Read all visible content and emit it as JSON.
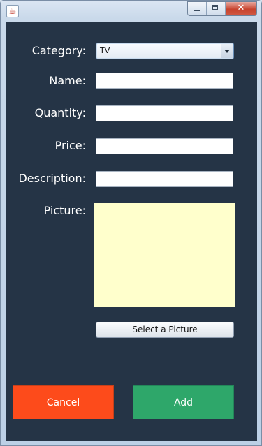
{
  "window": {
    "app_icon": "java-coffee-icon",
    "controls": {
      "minimize": "minimize-icon",
      "maximize": "maximize-icon",
      "close": "close-icon",
      "close_glyph": "✕"
    }
  },
  "form": {
    "category_label": "Category:",
    "category_value": "TV",
    "name_label": "Name:",
    "name_value": "",
    "quantity_label": "Quantity:",
    "quantity_value": "",
    "price_label": "Price:",
    "price_value": "",
    "description_label": "Description:",
    "description_value": "",
    "picture_label": "Picture:"
  },
  "buttons": {
    "select_picture": "Select a Picture",
    "cancel": "Cancel",
    "add": "Add"
  },
  "colors": {
    "panel_bg": "#253446",
    "picture_bg": "#ffffcc",
    "cancel_bg": "#fd4b1b",
    "add_bg": "#2ea76a"
  }
}
